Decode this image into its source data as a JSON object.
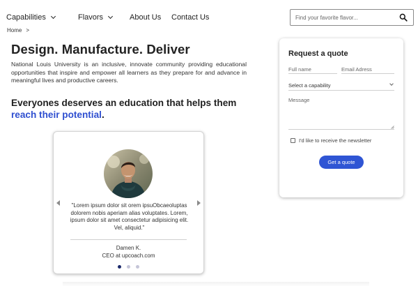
{
  "nav": {
    "items": [
      {
        "label": "Capabilities",
        "has_dropdown": true
      },
      {
        "label": "Flavors",
        "has_dropdown": true
      },
      {
        "label": "About Us",
        "has_dropdown": false
      },
      {
        "label": "Contact Us",
        "has_dropdown": false
      }
    ],
    "search": {
      "placeholder": "Find your favorite flavor...",
      "icon": "search-icon"
    }
  },
  "breadcrumb": {
    "home": "Home",
    "separator": ">"
  },
  "hero": {
    "title": "Design. Manufacture. Deliver",
    "text": "National Louis University is an inclusive, innovate community providing educational opportunities that inspire and empower all learners as they prepare for and advance in meaningful lives and productive careers.",
    "tagline_prefix": "Everyones deserves an education that helps them",
    "tagline_highlight": "reach their potential",
    "tagline_suffix": "."
  },
  "testimonial": {
    "quote": "\"Lorem ipsum dolor sit orem ipsuObcaeoluptas dolorem nobis aperiam alias voluptates. Lorem, ipsum dolor sit amet consectetur adipisicing elit. Vel, aliquid.\"",
    "author_name": "Damen K.",
    "author_title": "CEO at upcoach.com",
    "slide_count": 3,
    "active_slide": 1
  },
  "quote_form": {
    "title": "Request a quote",
    "full_name_placeholder": "Full name",
    "email_placeholder": "Email Adress",
    "capability_select": "Select a capability",
    "message_placeholder": "Message",
    "newsletter_label": "I'd like to receive the newsletter",
    "newsletter_checked": false,
    "submit_label": "Get a quote"
  },
  "colors": {
    "accent": "#2f55d4",
    "highlight_text": "#2f4fd0",
    "active_dot": "#1c2a6b",
    "inactive_dot": "#c5c5d8"
  }
}
